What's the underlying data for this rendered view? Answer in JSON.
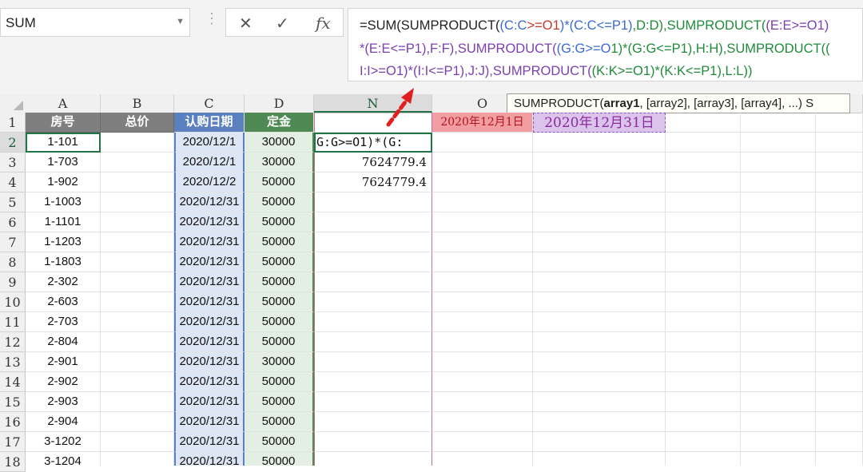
{
  "namebox": {
    "value": "SUM"
  },
  "formula_bar": {
    "cancel_icon": "✕",
    "enter_icon": "✓",
    "fx_label": "fx",
    "lines": [
      [
        [
          "=SUM(SUMPRODUCT(",
          ""
        ],
        [
          "(C:C",
          ""
        ],
        [
          ">=O1",
          ""
        ],
        [
          ")*(C:C<=P1)",
          ""
        ],
        [
          ",D:D),SUMPRODUCT(",
          ""
        ],
        [
          "(E:E>=O1)",
          ""
        ]
      ],
      [
        [
          "*(E:E<=P1),F:F),SUMPRODUCT(",
          ""
        ],
        [
          "(G:G>=O",
          ""
        ],
        [
          "1)*(G:G<=P1),H:H),SUMPRODUCT((",
          ""
        ]
      ],
      [
        [
          "I:I>=O1)*(I:I<=P1),J:J),SUMPRODUCT(",
          ""
        ],
        [
          "(K:K>=O1)*(K:K<=P1),L:L))",
          ""
        ]
      ]
    ]
  },
  "columns": [
    "A",
    "B",
    "C",
    "D",
    "N",
    "O"
  ],
  "rows": [
    "1",
    "2",
    "3",
    "4",
    "5",
    "6",
    "7",
    "8",
    "9",
    "10",
    "11",
    "12",
    "13",
    "14",
    "15",
    "16",
    "17",
    "18"
  ],
  "headers": {
    "A1": "房号",
    "B1": "总价",
    "C1": "认购日期",
    "D1": "定金"
  },
  "table": [
    {
      "room": "1-101",
      "date": "2020/12/1",
      "deposit": "30000"
    },
    {
      "room": "1-703",
      "date": "2020/12/1",
      "deposit": "30000"
    },
    {
      "room": "1-902",
      "date": "2020/12/2",
      "deposit": "50000"
    },
    {
      "room": "1-1003",
      "date": "2020/12/31",
      "deposit": "50000"
    },
    {
      "room": "1-1101",
      "date": "2020/12/31",
      "deposit": "50000"
    },
    {
      "room": "1-1203",
      "date": "2020/12/31",
      "deposit": "50000"
    },
    {
      "room": "1-1803",
      "date": "2020/12/31",
      "deposit": "50000"
    },
    {
      "room": "2-302",
      "date": "2020/12/31",
      "deposit": "50000"
    },
    {
      "room": "2-603",
      "date": "2020/12/31",
      "deposit": "50000"
    },
    {
      "room": "2-703",
      "date": "2020/12/31",
      "deposit": "50000"
    },
    {
      "room": "2-804",
      "date": "2020/12/31",
      "deposit": "50000"
    },
    {
      "room": "2-901",
      "date": "2020/12/31",
      "deposit": "30000"
    },
    {
      "room": "2-902",
      "date": "2020/12/31",
      "deposit": "50000"
    },
    {
      "room": "2-903",
      "date": "2020/12/31",
      "deposit": "50000"
    },
    {
      "room": "2-904",
      "date": "2020/12/31",
      "deposit": "50000"
    },
    {
      "room": "3-1202",
      "date": "2020/12/31",
      "deposit": "50000"
    },
    {
      "room": "3-1204",
      "date": "2020/12/31",
      "deposit": "50000"
    }
  ],
  "cells": {
    "N2": "G:G>=O1)*(G:",
    "N3": "7624779.4",
    "N4": "7624779.4",
    "O1": "2020年12月1日",
    "P1": "2020年12月31日"
  },
  "tooltip": {
    "fn": "SUMPRODUCT(",
    "arg1": "array1",
    "rest": ", [array2], [array3], [array4], ...)",
    "trail": "S"
  },
  "colors": {
    "accent": "#217346",
    "arrow": "#e02020",
    "date_col": "#5b7fbf",
    "deposit_col": "#4f8a55",
    "o1_fill": "#f19ea2",
    "p1_fill": "#dcc3ec"
  }
}
